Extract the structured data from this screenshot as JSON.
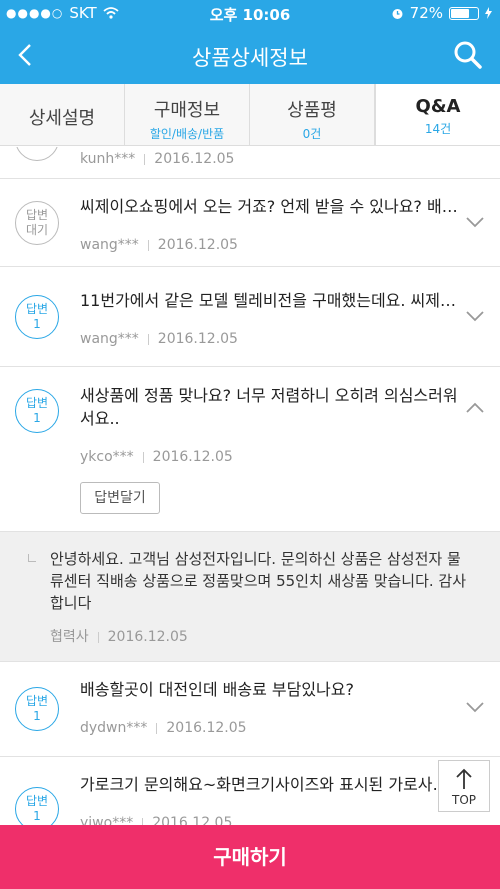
{
  "status_bar": {
    "signal_dots": "●●●●○",
    "carrier": "SKT",
    "time": "오후 10:06",
    "battery_percent": "72%",
    "battery_level": 0.72
  },
  "header": {
    "title": "상품상세정보"
  },
  "tabs": [
    {
      "label": "상세설명",
      "sub": ""
    },
    {
      "label": "구매정보",
      "sub": "할인/배송/반품"
    },
    {
      "label": "상품평",
      "sub": "0건"
    },
    {
      "label": "Q&A",
      "sub": "14건"
    }
  ],
  "items": [
    {
      "badge_line1": "",
      "badge_line2": "",
      "question": "",
      "user": "kunh***",
      "date": "2016.12.05"
    },
    {
      "badge_line1": "답변",
      "badge_line2": "대기",
      "question": "씨제이오쇼핑에서 오는 거죠? 언제 받을 수 있나요? 배송...",
      "user": "wang***",
      "date": "2016.12.05"
    },
    {
      "badge_line1": "답변",
      "badge_line2": "1",
      "question": "11번가에서 같은 모델 텔레비전을 구매했는데요. 씨제이...",
      "user": "wang***",
      "date": "2016.12.05"
    },
    {
      "badge_line1": "답변",
      "badge_line2": "1",
      "question": "새상품에 정품 맞나요? 너무 저렴하니 오히려 의심스러워서요..",
      "user": "ykco***",
      "date": "2016.12.05",
      "reply_button": "답변달기"
    },
    {
      "badge_line1": "답변",
      "badge_line2": "1",
      "question": "배송할곳이 대전인데 배송료 부담있나요?",
      "user": "dydwn***",
      "date": "2016.12.05"
    },
    {
      "badge_line1": "답변",
      "badge_line2": "1",
      "question": "가로크기 문의해요~화면크기사이즈와 표시된 가로사이즈...",
      "user": "yiwo***",
      "date": "2016.12.05"
    }
  ],
  "answer": {
    "text": "안녕하세요. 고객님 삼성전자입니다. 문의하신 상품은 삼성전자 물류센터 직배송 상품으로 정품맞으며 55인치 새상품 맞습니다. 감사합니다",
    "author": "협력사",
    "date": "2016.12.05"
  },
  "top_button": {
    "label": "TOP"
  },
  "buy_button": {
    "label": "구매하기"
  },
  "colors": {
    "header": "#2aa7e6",
    "buy": "#ef2f6a"
  }
}
